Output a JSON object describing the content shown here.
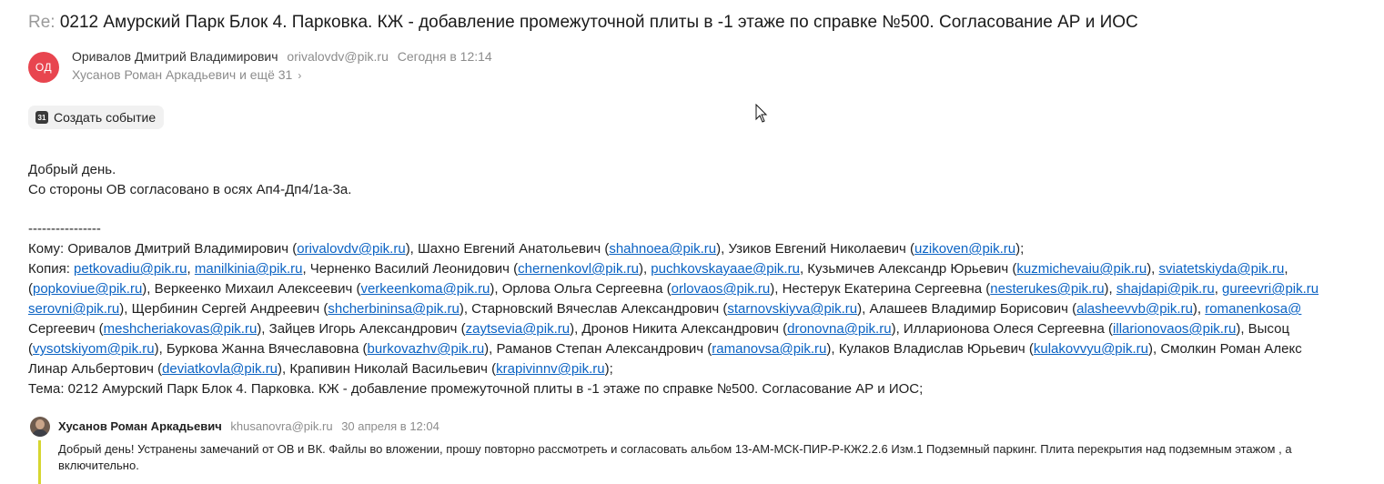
{
  "email": {
    "subject_prefix": "Re:",
    "subject": "0212 Амурский Парк Блок 4. Парковка. КЖ - добавление промежуточной плиты в -1 этаже по справке №500. Согласование АР и ИОС",
    "sender": {
      "initials": "ОД",
      "avatar_color": "#e8454f",
      "name": "Оривалов Дмитрий Владимирович",
      "address": "orivalovdv@pik.ru",
      "date": "Сегодня в 12:14"
    },
    "recipients_summary": "Хусанов Роман Аркадьевич и ещё 31",
    "create_event_label": "Создать событие",
    "calendar_icon_text": "31",
    "body": {
      "greeting": "Добрый день.",
      "line2": "Со стороны ОВ согласовано в осях Ап4-Дп4/1а-3а.",
      "separator": "----------------",
      "l1": {
        "t0": "Кому: Оривалов Дмитрий Владимирович (",
        "a0": "orivalovdv@pik.ru",
        "t1": "), Шахно Евгений Анатольевич (",
        "a1": "shahnoea@pik.ru",
        "t2": "), Узиков Евгений Николаевич (",
        "a2": "uzikoven@pik.ru",
        "t3": ");"
      },
      "l2": {
        "t0": "Копия: ",
        "a0": "petkovadiu@pik.ru",
        "t1": ", ",
        "a1": "manilkinia@pik.ru",
        "t2": ", Черненко Василий Леонидович (",
        "a2": "chernenkovl@pik.ru",
        "t3": "), ",
        "a3": "puchkovskayaae@pik.ru",
        "t4": ", Кузьмичев Александр Юрьевич (",
        "a4": "kuzmichevaiu@pik.ru",
        "t5": "), ",
        "a5": "sviatetskiyda@pik.ru",
        "t6": ","
      },
      "l3": {
        "t0": "(",
        "a0": "popkoviue@pik.ru",
        "t1": "), Веркеенко Михаил Алексеевич (",
        "a1": "verkeenkoma@pik.ru",
        "t2": "), Орлова Ольга Сергеевна (",
        "a2": "orlovaos@pik.ru",
        "t3": "), Нестерук Екатерина Сергеевна (",
        "a3": "nesterukes@pik.ru",
        "t4": "), ",
        "a4": "shajdapi@pik.ru",
        "t5": ", ",
        "a5": "gureevri@pik.ru"
      },
      "l4": {
        "a0": "serovni@pik.ru",
        "t1": "), Щербинин Сергей Андреевич (",
        "a1": "shcherbininsa@pik.ru",
        "t2": "), Старновский Вячеслав Александрович (",
        "a2": "starnovskiyva@pik.ru",
        "t3": "), Алашеев Владимир Борисович (",
        "a3": "alasheevvb@pik.ru",
        "t4": "), ",
        "a4": "romanenkosa@"
      },
      "l5": {
        "t0": "Сергеевич (",
        "a0": "meshcheriakovas@pik.ru",
        "t1": "), Зайцев Игорь Александрович (",
        "a1": "zaytsevia@pik.ru",
        "t2": "), Дронов Никита Александрович (",
        "a2": "dronovna@pik.ru",
        "t3": "), Илларионова Олеся Сергеевна (",
        "a3": "illarionovaos@pik.ru",
        "t4": "), Высоц"
      },
      "l6": {
        "t0": "(",
        "a0": "vysotskiyom@pik.ru",
        "t1": "), Буркова Жанна Вячеславовна (",
        "a1": "burkovazhv@pik.ru",
        "t2": "), Раманов Степан Александрович (",
        "a2": "ramanovsa@pik.ru",
        "t3": "), Кулаков Владислав Юрьевич (",
        "a3": "kulakovvyu@pik.ru",
        "t4": "), Смолкин Роман Алекс"
      },
      "l7": {
        "t0": "Линар Альбертович (",
        "a0": "deviatkovla@pik.ru",
        "t1": "), Крапивин Николай Васильевич (",
        "a1": "krapivinnv@pik.ru",
        "t2": ");"
      },
      "topic": "Тема: 0212 Амурский Парк Блок 4. Парковка. КЖ - добавление промежуточной плиты в -1 этаже по справке №500. Согласование АР и ИОС;"
    },
    "quote": {
      "name": "Хусанов Роман Аркадьевич",
      "address": "khusanovra@pik.ru",
      "date": "30 апреля в 12:04",
      "line1": "Добрый день! Устранены замечаний от ОВ и ВК. Файлы во вложении, прошу повторно рассмотреть и согласовать альбом 13-АМ-МСК-ПИР-Р-КЖ2.2.6 Изм.1  Подземный паркинг. Плита перекрытия над подземным этажом , а",
      "line2": "включительно.",
      "bar_color": "#d6d630"
    },
    "link_color": "#0b63c4"
  }
}
